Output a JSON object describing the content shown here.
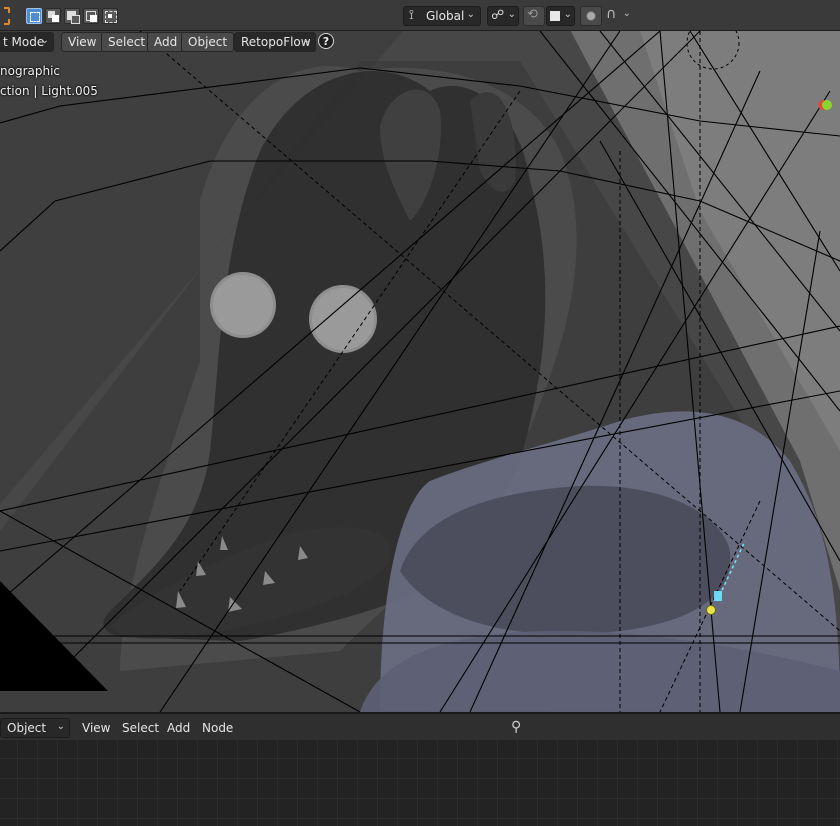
{
  "toolbar": {
    "select_mode_icons": [
      "select-box-icon",
      "extend-icon",
      "subtract-icon",
      "invert-icon",
      "intersect-icon"
    ],
    "orientation_label": "Global",
    "snap_icons": [
      "link-icon",
      "magnet-icon",
      "square-icon",
      "proportional-icon",
      "falloff-icon"
    ]
  },
  "viewport_header": {
    "mode_label": "t Mode",
    "menu": [
      "View",
      "Select",
      "Add",
      "Object"
    ],
    "addon_label": "RetopoFlow",
    "help_icon": "?"
  },
  "viewport": {
    "view_name": "nographic",
    "collection_text": "ction | Light.005"
  },
  "node_editor": {
    "mode_label": "Object",
    "menu": [
      "View",
      "Select",
      "Add",
      "Node"
    ],
    "pin_icon": "pin-icon"
  },
  "colors": {
    "accent_blue": "#4f8cd1",
    "gizmo_green": "#8ad62c",
    "gizmo_red": "#d64b3b",
    "light_yellow": "#e8e34a",
    "light_cyan": "#6ee6ff"
  }
}
